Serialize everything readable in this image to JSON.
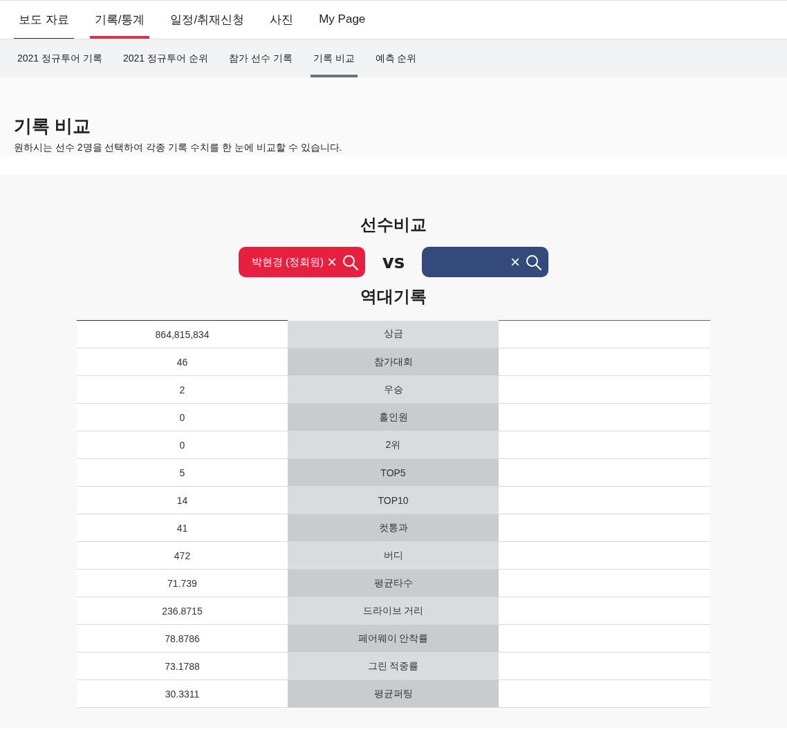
{
  "main_nav": [
    {
      "label": "보도 자료",
      "selected": false,
      "hovered": true
    },
    {
      "label": "기록/통계",
      "selected": true,
      "hovered": false
    },
    {
      "label": "일정/취재신청",
      "selected": false,
      "hovered": false
    },
    {
      "label": "사진",
      "selected": false,
      "hovered": false
    },
    {
      "label": "My Page",
      "selected": false,
      "hovered": false
    }
  ],
  "sub_nav": [
    {
      "label": "2021 정규투어 기록",
      "selected": false
    },
    {
      "label": "2021 정규투어 순위",
      "selected": false
    },
    {
      "label": "참가 선수 기록",
      "selected": false
    },
    {
      "label": "기록 비교",
      "selected": true
    },
    {
      "label": "예측 순위",
      "selected": false
    }
  ],
  "page_header": {
    "title": "기록 비교",
    "description": "원하시는 선수 2명을 선택하여 각종 기록 수치를 한 눈에 비교할 수 있습니다."
  },
  "comparison": {
    "title": "선수비교",
    "players": [
      {
        "value": "박현경 (정회원)",
        "color": "#e8203f"
      },
      {
        "color": "#334a7a"
      }
    ],
    "versus": "vs",
    "records_title": "역대기록",
    "rows": [
      {
        "label": "상금",
        "player_1": "864,815,834"
      },
      {
        "label": "참가대회",
        "player_1": "46"
      },
      {
        "label": "우승",
        "player_1": "2"
      },
      {
        "label": "홀인원",
        "player_1": "0"
      },
      {
        "label": "2위",
        "player_1": "0"
      },
      {
        "label": "TOP5",
        "player_1": "5"
      },
      {
        "label": "TOP10",
        "player_1": "14"
      },
      {
        "label": "컷통과",
        "player_1": "41"
      },
      {
        "label": "버디",
        "player_1": "472"
      },
      {
        "label": "평균타수",
        "player_1": "71.739"
      },
      {
        "label": "드라이브 거리",
        "player_1": "236.8715"
      },
      {
        "label": "페어웨이 안착률",
        "player_1": "78.8786"
      },
      {
        "label": "그린 적중률",
        "player_1": "73.1788"
      },
      {
        "label": "평균퍼팅",
        "player_1": "30.3311"
      }
    ]
  }
}
